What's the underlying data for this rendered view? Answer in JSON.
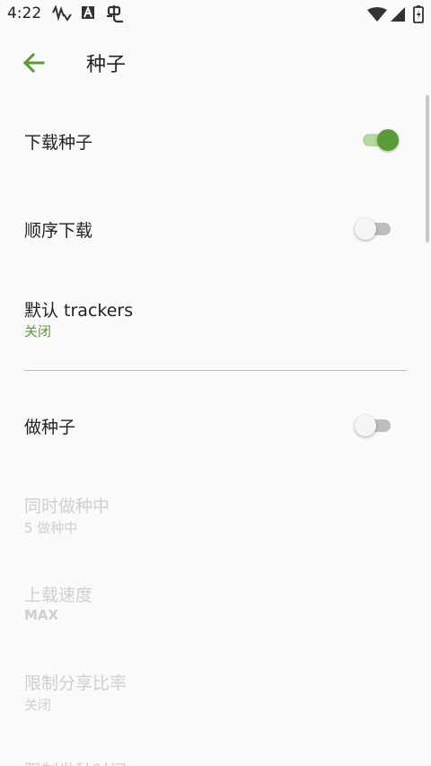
{
  "status_bar": {
    "time": "4:22",
    "icons": [
      "activity-icon",
      "a-badge-icon",
      "bug-icon",
      "wifi-icon",
      "signal-icon",
      "battery-icon"
    ]
  },
  "toolbar": {
    "title": "种子",
    "back_icon": "arrow-left-icon"
  },
  "colors": {
    "accent": "#5a9a37",
    "accent_light": "#b7d7a0",
    "disabled_text": "#cfcfcf"
  },
  "settings": {
    "download_torrents": {
      "label": "下载种子",
      "enabled": true
    },
    "sequential_download": {
      "label": "顺序下载",
      "enabled": false
    },
    "default_trackers": {
      "label": "默认 trackers",
      "value": "关闭"
    },
    "seeding": {
      "label": "做种子",
      "enabled": false
    },
    "concurrent_seeding": {
      "label": "同时做种中",
      "value": "5 做种中"
    },
    "upload_speed": {
      "label": "上载速度",
      "value": "MAX"
    },
    "share_ratio": {
      "label": "限制分享比率",
      "value": "关闭"
    },
    "seeding_time": {
      "label": "限制做种时间"
    }
  }
}
